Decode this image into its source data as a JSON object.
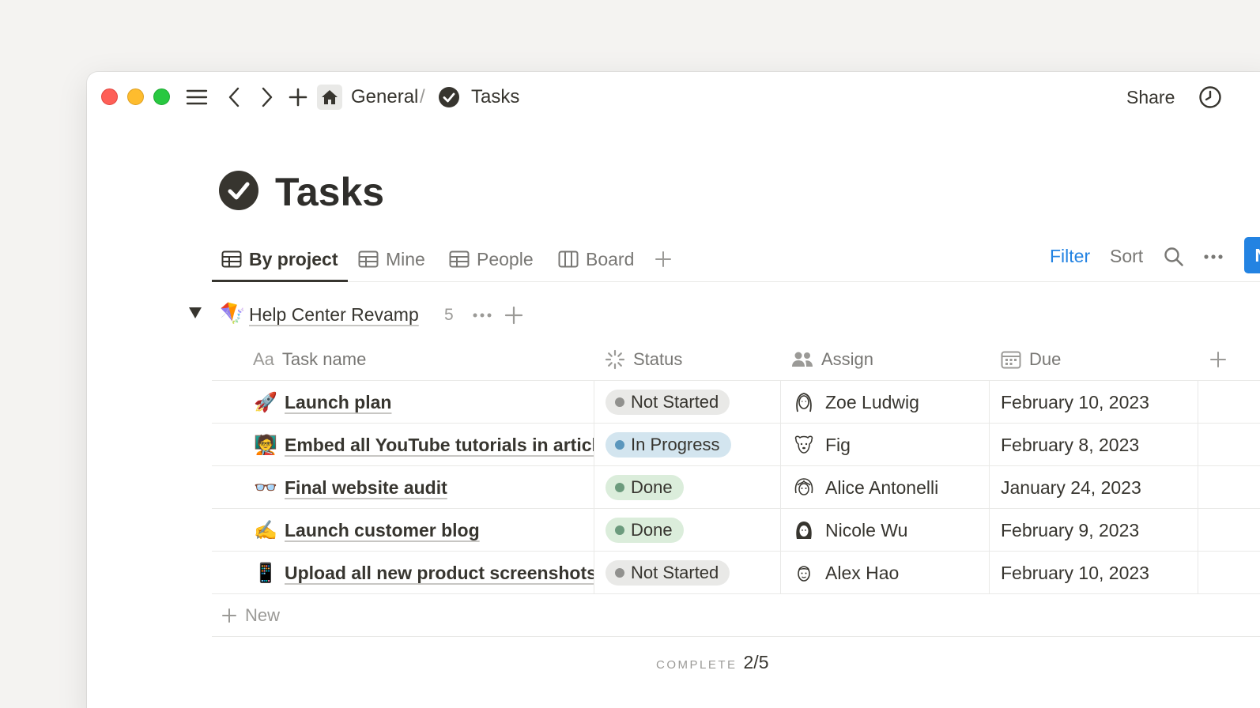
{
  "window": {
    "breadcrumb": {
      "parent": "General",
      "separator": "/",
      "current": "Tasks"
    },
    "share_label": "Share",
    "icons": [
      "menu-icon",
      "back-icon",
      "forward-icon",
      "plus-icon",
      "home-icon",
      "check-circle-icon",
      "clock-icon"
    ]
  },
  "page": {
    "title": "Tasks"
  },
  "views": {
    "tabs": [
      {
        "label": "By project",
        "icon": "table-icon",
        "active": true
      },
      {
        "label": "Mine",
        "icon": "table-icon",
        "active": false
      },
      {
        "label": "People",
        "icon": "table-icon",
        "active": false
      },
      {
        "label": "Board",
        "icon": "board-icon",
        "active": false
      }
    ],
    "filter_label": "Filter",
    "sort_label": "Sort",
    "new_label": "New"
  },
  "group": {
    "emoji": "🪁",
    "title": "Help Center Revamp",
    "count": "5"
  },
  "table": {
    "columns": {
      "name_prefix": "Aa",
      "name": "Task name",
      "status": "Status",
      "assign": "Assign",
      "due": "Due"
    },
    "rows": [
      {
        "emoji": "🚀",
        "name": "Launch plan",
        "status": "Not Started",
        "assignee": "Zoe Ludwig",
        "due": "February 10, 2023"
      },
      {
        "emoji": "🧑‍🏫",
        "name": "Embed all YouTube tutorials in articles",
        "status": "In Progress",
        "assignee": "Fig",
        "due": "February 8, 2023"
      },
      {
        "emoji": "👓",
        "name": "Final website audit",
        "status": "Done",
        "assignee": "Alice Antonelli",
        "due": "January 24, 2023"
      },
      {
        "emoji": "✍️",
        "name": "Launch customer blog",
        "status": "Done",
        "assignee": "Nicole Wu",
        "due": "February 9, 2023"
      },
      {
        "emoji": "📱",
        "name": "Upload all new product screenshots",
        "status": "Not Started",
        "assignee": "Alex Hao",
        "due": "February 10, 2023"
      }
    ],
    "add_row_label": "New",
    "calc_label": "COMPLETE",
    "calc_value": "2/5"
  },
  "status_colors": {
    "Not Started": {
      "bg": "#e9e9e7",
      "dot": "#91918e"
    },
    "In Progress": {
      "bg": "#d3e5ef",
      "dot": "#5b97bd"
    },
    "Done": {
      "bg": "#dbeddb",
      "dot": "#6c9b7d"
    }
  },
  "accent_color": "#2383e2"
}
